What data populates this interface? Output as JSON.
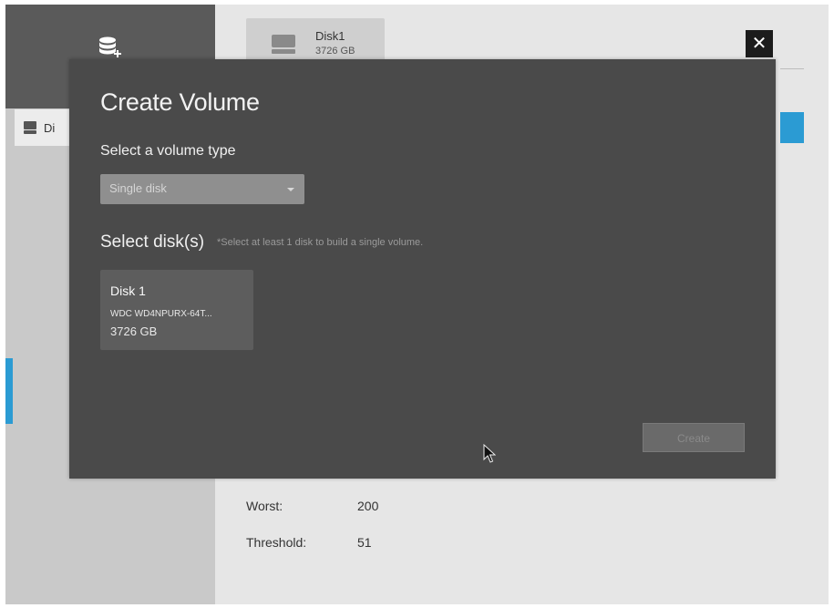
{
  "background_app": {
    "sidebar_item_label": "Di",
    "disk_card": {
      "name": "Disk1",
      "size": "3726 GB"
    },
    "stats": [
      {
        "label": "Worst:",
        "value": "200"
      },
      {
        "label": "Threshold:",
        "value": "51"
      }
    ]
  },
  "modal": {
    "title": "Create Volume",
    "close_label": "✕",
    "volume_type_label": "Select a volume type",
    "volume_type_value": "Single disk",
    "select_disks_label": "Select disk(s)",
    "select_disks_hint": "*Select at least 1 disk to build a single volume.",
    "disks": [
      {
        "name": "Disk 1",
        "model": "WDC WD4NPURX-64T...",
        "size": "3726 GB"
      }
    ],
    "create_label": "Create"
  },
  "icons": {
    "add_volume": "database-plus-icon",
    "close": "close-icon",
    "caret": "chevron-down-icon",
    "cursor": "mouse-pointer-icon"
  },
  "colors": {
    "modal_bg": "#4a4a4a",
    "accent": "#2b9bd3",
    "sidebar_dark": "#5a5a5a"
  }
}
